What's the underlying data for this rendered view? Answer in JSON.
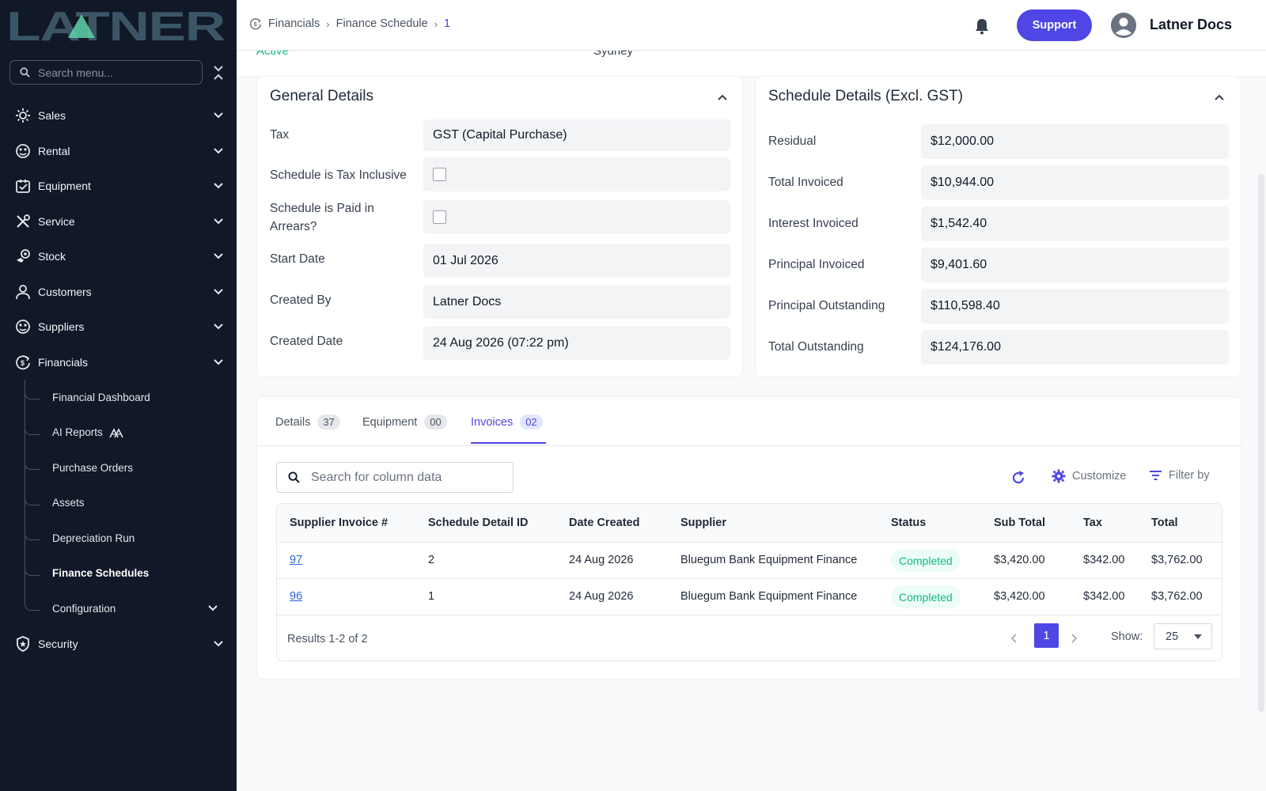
{
  "brand": {
    "logo_text": "LATNER"
  },
  "sidebar": {
    "search_placeholder": "Search menu...",
    "items": [
      {
        "label": "Sales",
        "icon": "sales-icon"
      },
      {
        "label": "Rental",
        "icon": "rental-icon"
      },
      {
        "label": "Equipment",
        "icon": "equipment-icon"
      },
      {
        "label": "Service",
        "icon": "service-icon"
      },
      {
        "label": "Stock",
        "icon": "stock-icon"
      },
      {
        "label": "Customers",
        "icon": "customers-icon"
      },
      {
        "label": "Suppliers",
        "icon": "suppliers-icon"
      },
      {
        "label": "Financials",
        "icon": "financials-icon"
      }
    ],
    "financial_sub": [
      {
        "label": "Financial Dashboard"
      },
      {
        "label": "AI Reports"
      },
      {
        "label": "Purchase Orders"
      },
      {
        "label": "Assets"
      },
      {
        "label": "Depreciation Run"
      },
      {
        "label": "Finance Schedules",
        "active": true
      },
      {
        "label": "Configuration"
      }
    ],
    "security": {
      "label": "Security",
      "icon": "shield-icon"
    }
  },
  "header": {
    "breadcrumb": [
      "Financials",
      "Finance Schedule",
      "1"
    ],
    "support_label": "Support",
    "user_name": "Latner Docs"
  },
  "prev": {
    "status": "Active",
    "location": "Sydney"
  },
  "general": {
    "title": "General Details",
    "tax_label": "Tax",
    "tax_value": "GST (Capital Purchase)",
    "tax_inclusive_label": "Schedule is Tax Inclusive",
    "tax_inclusive_checked": false,
    "arrears_label": "Schedule is Paid in Arrears?",
    "arrears_checked": false,
    "start_label": "Start Date",
    "start_value": "01 Jul 2026",
    "created_by_label": "Created By",
    "created_by_value": "Latner Docs",
    "created_date_label": "Created Date",
    "created_date_value": "24 Aug 2026 (07:22 pm)"
  },
  "schedule": {
    "title": "Schedule Details (Excl. GST)",
    "rows": [
      {
        "label": "Residual",
        "value": "$12,000.00"
      },
      {
        "label": "Total Invoiced",
        "value": "$10,944.00"
      },
      {
        "label": "Interest Invoiced",
        "value": "$1,542.40"
      },
      {
        "label": "Principal Invoiced",
        "value": "$9,401.60"
      },
      {
        "label": "Principal Outstanding",
        "value": "$110,598.40"
      },
      {
        "label": "Total Outstanding",
        "value": "$124,176.00"
      }
    ]
  },
  "tabs": [
    {
      "label": "Details",
      "count": "37"
    },
    {
      "label": "Equipment",
      "count": "00"
    },
    {
      "label": "Invoices",
      "count": "02",
      "active": true
    }
  ],
  "invoices": {
    "search_placeholder": "Search for column data",
    "customize_label": "Customize",
    "filter_label": "Filter by",
    "columns": [
      "Supplier Invoice #",
      "Schedule Detail ID",
      "Date Created",
      "Supplier",
      "Status",
      "Sub Total",
      "Tax",
      "Total"
    ],
    "rows": [
      {
        "invoice": "97",
        "detail_id": "2",
        "date": "24 Aug 2026",
        "supplier": "Bluegum Bank Equipment Finance",
        "status": "Completed",
        "subtotal": "$3,420.00",
        "tax": "$342.00",
        "total": "$3,762.00"
      },
      {
        "invoice": "96",
        "detail_id": "1",
        "date": "24 Aug 2026",
        "supplier": "Bluegum Bank Equipment Finance",
        "status": "Completed",
        "subtotal": "$3,420.00",
        "tax": "$342.00",
        "total": "$3,762.00"
      }
    ],
    "results_text": "Results 1-2 of 2",
    "current_page": "1",
    "show_label": "Show:",
    "page_size": "25"
  },
  "colors": {
    "accent": "#4f46e5",
    "sidebar_bg": "#111827",
    "success": "#10b981",
    "logo": "#3b5566"
  }
}
